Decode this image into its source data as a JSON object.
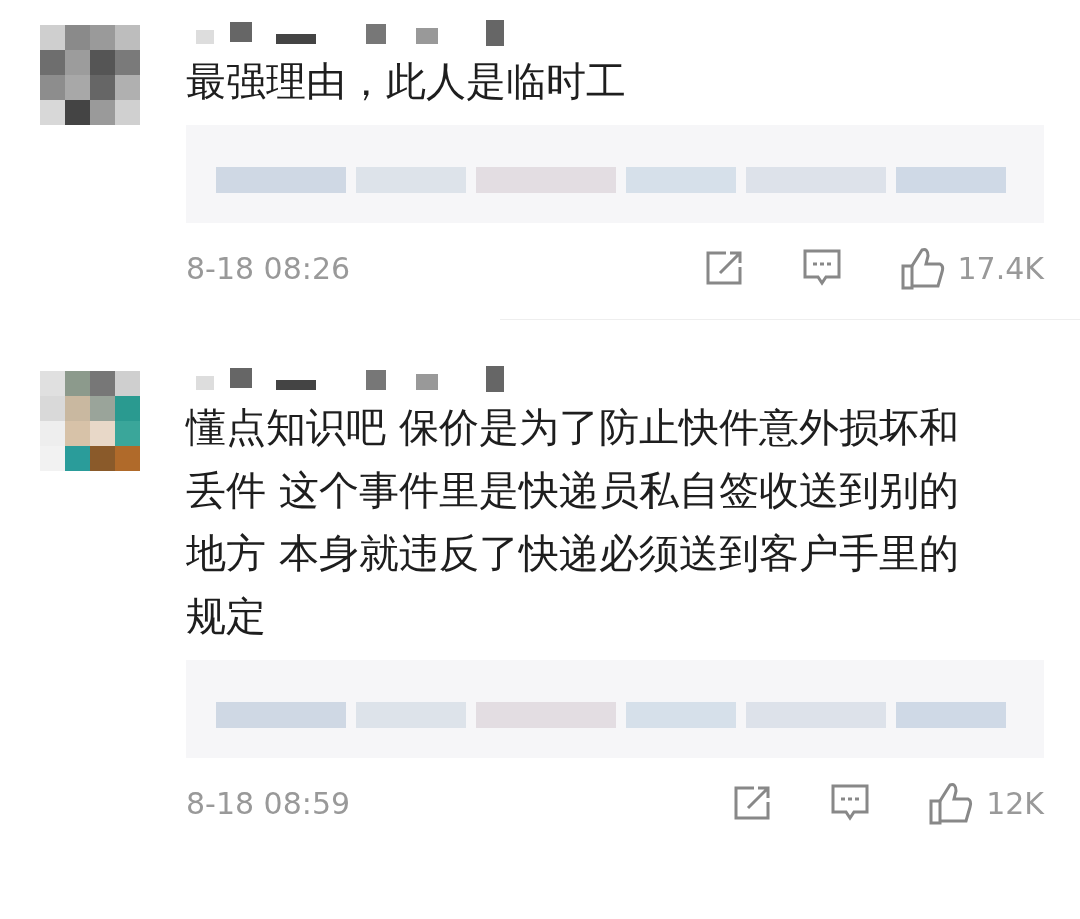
{
  "comments": [
    {
      "lines": [
        "最强理由，此人是临时工"
      ],
      "time": "8-18 08:26",
      "likes": "17.4K"
    },
    {
      "lines": [
        "懂点知识吧 保价是为了防止快件意外损坏和",
        "丢件 这个事件里是快递员私自签收送到别的",
        "地方 本身就违反了快递必须送到客户手里的",
        "规定"
      ],
      "time": "8-18 08:59",
      "likes": "12K"
    }
  ]
}
